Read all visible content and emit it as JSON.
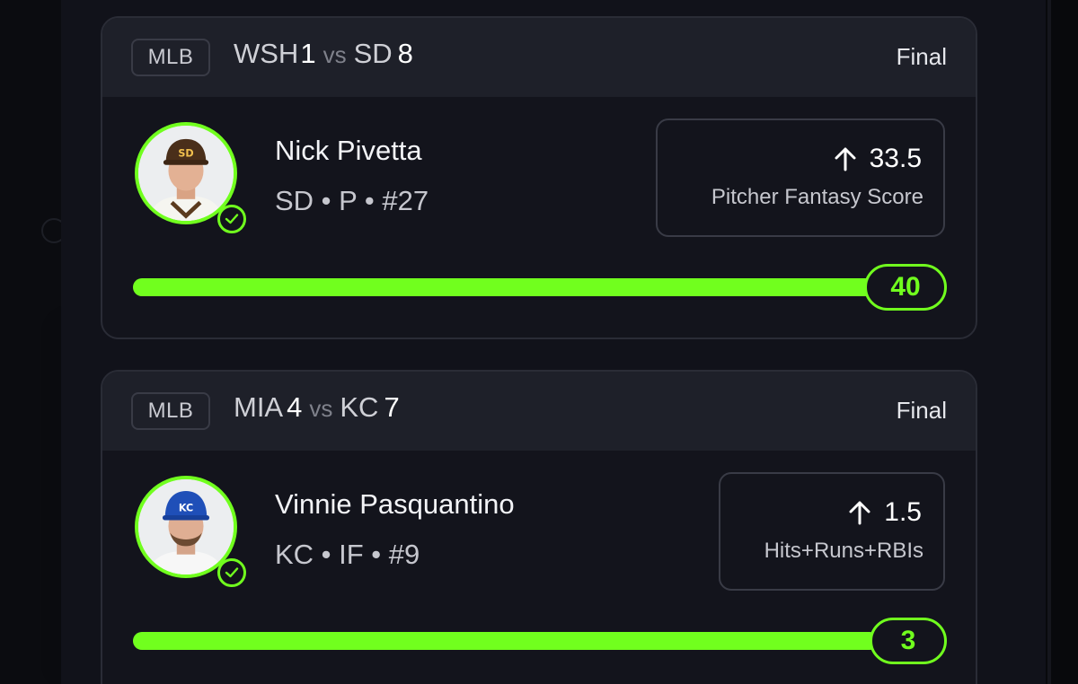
{
  "cards": [
    {
      "league": "MLB",
      "away_team": "WSH",
      "away_score": "1",
      "vs": "vs",
      "home_team": "SD",
      "home_score": "8",
      "status": "Final",
      "player": {
        "name": "Nick Pivetta",
        "meta": "SD • P • #27",
        "avatar_icon": "player-headshot-padres"
      },
      "stat": {
        "direction_icon": "arrow-up-icon",
        "line": "33.5",
        "label": "Pitcher Fantasy Score"
      },
      "progress": {
        "result": "40",
        "fill_fraction": 1.0
      }
    },
    {
      "league": "MLB",
      "away_team": "MIA",
      "away_score": "4",
      "vs": "vs",
      "home_team": "KC",
      "home_score": "7",
      "status": "Final",
      "player": {
        "name": "Vinnie Pasquantino",
        "meta": "KC • IF • #9",
        "avatar_icon": "player-headshot-royals"
      },
      "stat": {
        "direction_icon": "arrow-up-icon",
        "line": "1.5",
        "label": "Hits+Runs+RBIs"
      },
      "progress": {
        "result": "3",
        "fill_fraction": 1.0
      }
    }
  ],
  "colors": {
    "accent_green": "#71ff1e",
    "card_bg": "#13141c",
    "header_bg": "#1e2029"
  }
}
